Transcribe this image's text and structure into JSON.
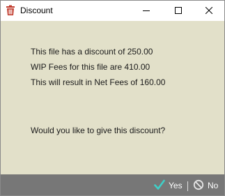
{
  "window": {
    "title": "Discount",
    "app_icon": "trash-bin-icon",
    "controls": [
      "minimize-icon",
      "maximize-icon",
      "close-icon"
    ]
  },
  "message": {
    "line1": "This file has a discount of 250.00",
    "line2": "WIP Fees for this file are 410.00",
    "line3": "This will result in Net Fees of 160.00",
    "question": "Would you like to give this discount?"
  },
  "buttons": {
    "yes_label": "Yes",
    "yes_icon": "checkmark-icon",
    "no_label": "No",
    "no_icon": "prohibited-icon"
  },
  "colors": {
    "content_bg": "#e2e0c9",
    "footer_bg": "#777777",
    "check_accent": "#3fd0c8",
    "app_icon_red": "#c0392b"
  }
}
